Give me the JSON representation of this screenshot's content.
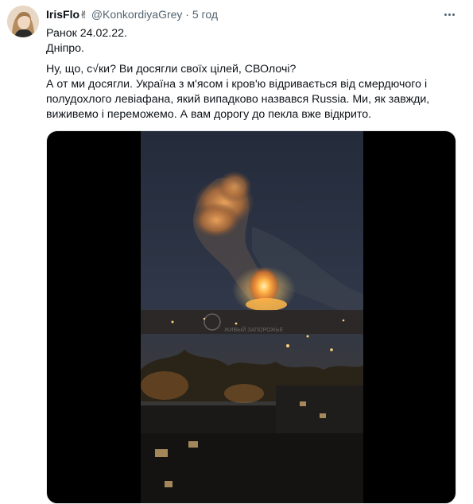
{
  "tweet": {
    "display_name": "IrisFlo",
    "emoji": "✌",
    "handle": "@KonkordiyaGrey",
    "separator": "·",
    "time": "5 год",
    "lines": [
      "Ранок 24.02.22.",
      "Дніпро.",
      "",
      "Ну, що, с√ки? Ви досягли своїх цілей, СВОлочі?",
      "А от ми досягли. Україна з м'ясом і кров'ю відривається від смердючого і",
      "полудохлого  левіафана, який випадково назвався Russia. Ми, як завжди,",
      "виживемо і переможемо. А вам дорогу до пекла вже відкрито."
    ]
  },
  "icons": {
    "avatar": "profile-photo",
    "more": "more-horizontal-icon"
  },
  "colors": {
    "text": "#0f1419",
    "secondary": "#536471",
    "media_background": "#000000",
    "night_sky": "#2a3346",
    "explosion": "#ff9a3c"
  },
  "media": {
    "watermark_text": "ЖИВЫЙ ЗАПОРОЖЬЕ"
  }
}
